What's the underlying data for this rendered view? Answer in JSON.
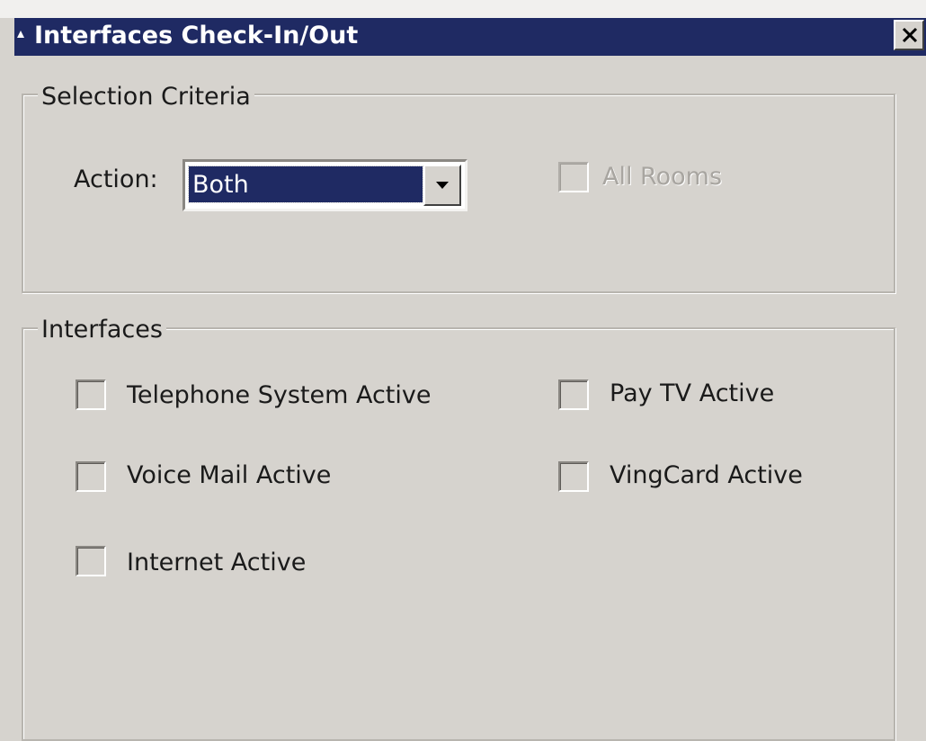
{
  "window": {
    "title": "Interfaces Check-In/Out",
    "close_symbol": "×"
  },
  "selection_criteria": {
    "legend": "Selection Criteria",
    "action_label": "Action:",
    "action_value": "Both",
    "all_rooms_label": "All Rooms",
    "all_rooms_enabled": false,
    "all_rooms_checked": false
  },
  "interfaces": {
    "legend": "Interfaces",
    "items": [
      {
        "label": "Telephone System Active",
        "checked": false
      },
      {
        "label": "Voice Mail Active",
        "checked": false
      },
      {
        "label": "Internet Active",
        "checked": false
      },
      {
        "label": "Pay TV Active",
        "checked": false
      },
      {
        "label": "VingCard Active",
        "checked": false
      }
    ]
  },
  "icons": {
    "title_icon": "app-icon",
    "close_icon": "close-icon",
    "dropdown_icon": "chevron-down-icon"
  },
  "colors": {
    "titlebar": "#1f2a63",
    "selection": "#1f2a63",
    "dialog_bg": "#d6d3ce"
  }
}
